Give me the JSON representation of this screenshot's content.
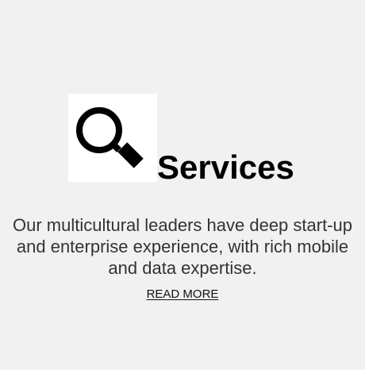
{
  "services_card": {
    "icon": "magnifying-glass-icon",
    "title": "Services",
    "description": "Our multicultural leaders have deep start-up and enterprise experience, with rich mobile and data expertise.",
    "read_more_label": "READ MORE"
  },
  "colors": {
    "background": "#f1f1f1",
    "icon_box": "#ffffff",
    "title": "#000000",
    "description": "#333333",
    "link": "#111111"
  }
}
